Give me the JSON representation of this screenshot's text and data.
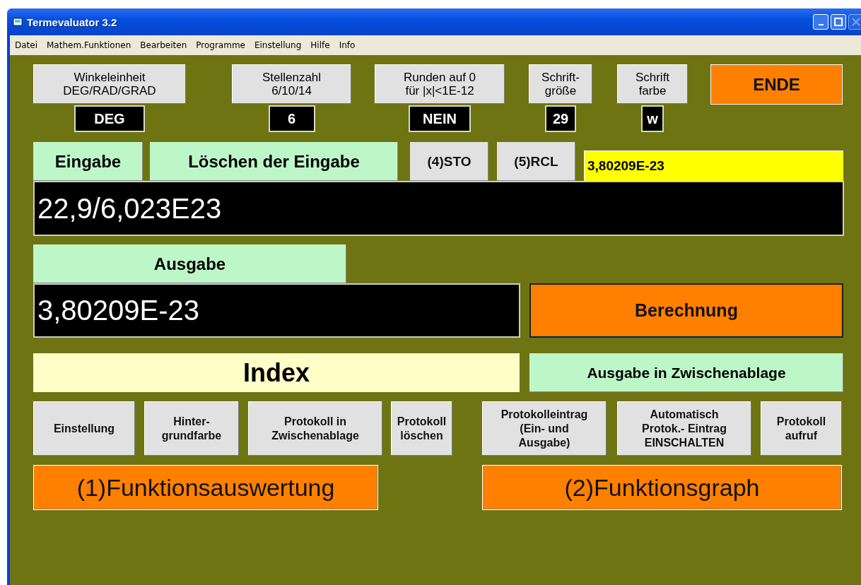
{
  "window": {
    "title": "Termevaluator 3.2"
  },
  "menu": [
    "Datei",
    "Mathem.Funktionen",
    "Bearbeiten",
    "Programme",
    "Einstellung",
    "Hilfe",
    "Info"
  ],
  "settings": [
    {
      "label": "Winkeleinheit\nDEG/RAD/GRAD",
      "value": "DEG"
    },
    {
      "label": "Stellenzahl\n6/10/14",
      "value": "6"
    },
    {
      "label": "Runden auf 0\nfür |x|<1E-12",
      "value": "NEIN"
    },
    {
      "label": "Schrift-\ngröße",
      "value": "29"
    },
    {
      "label": "Schrift\nfarbe",
      "value": "w"
    }
  ],
  "end_button": "ENDE",
  "input_row": {
    "label": "Eingabe",
    "clear": "Löschen der Eingabe",
    "sto": "(4)STO",
    "rcl": "(5)RCL",
    "memory": "3,80209E-23"
  },
  "input": {
    "value": "22,9/6,023E23"
  },
  "output_label": "Ausgabe",
  "output": {
    "value": "3,80209E-23"
  },
  "calculate_button": "Berechnung",
  "index_button": "Index",
  "clipboard_button": "Ausgabe in Zwischenablage",
  "log_buttons": [
    "Einstellung",
    "Hinter-\ngrundfarbe",
    "Protokoll in\nZwischenablage",
    "Protokoll\nlöschen",
    "Protokolleintrag\n(Ein- und\nAusgabe)",
    "Automatisch\nProtok.- Eintrag\nEINSCHALTEN",
    "Protokoll\naufruf"
  ],
  "function_buttons": [
    "(1)Funktionsauswertung",
    "(2)Funktionsgraph"
  ]
}
